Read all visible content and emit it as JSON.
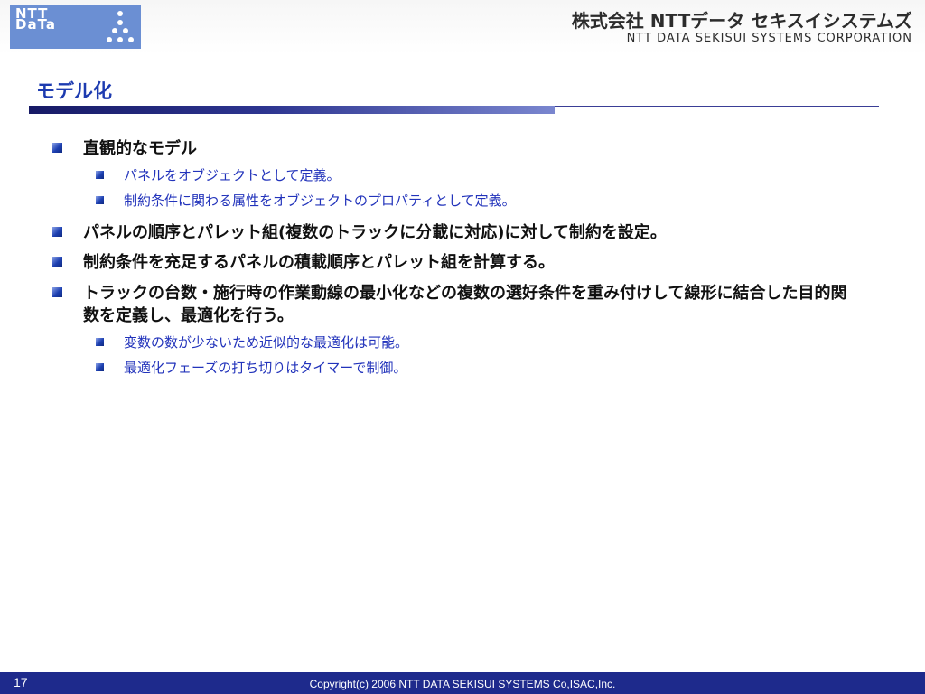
{
  "header": {
    "logo_text": "NTT DaTa",
    "company_name_jp": "株式会社 NTTデータ セキスイシステムズ",
    "company_name_en": "NTT DATA SEKISUI SYSTEMS CORPORATION"
  },
  "slide": {
    "title": "モデル化",
    "bullets": [
      {
        "text": "直観的なモデル",
        "sub": [
          "パネルをオブジェクトとして定義。",
          "制約条件に関わる属性をオブジェクトのプロパティとして定義。"
        ]
      },
      {
        "text": "パネルの順序とパレット組(複数のトラックに分載に対応)に対して制約を設定。",
        "sub": []
      },
      {
        "text": "制約条件を充足するパネルの積載順序とパレット組を計算する。",
        "sub": []
      },
      {
        "text": "トラックの台数・施行時の作業動線の最小化などの複数の選好条件を重み付けして線形に結合した目的関数を定義し、最適化を行う。",
        "sub": [
          "変数の数が少ないため近似的な最適化は可能。",
          "最適化フェーズの打ち切りはタイマーで制御。"
        ]
      }
    ]
  },
  "footer": {
    "page_number": "17",
    "copyright": "Copyright(c) 2006 NTT DATA SEKISUI SYSTEMS Co,ISAC,Inc."
  },
  "colors": {
    "title": "#1d3bb0",
    "sub_bullet_text": "#2233bb",
    "footer_bg": "#1e2a8c",
    "logo_bg": "#6b8fd3"
  }
}
